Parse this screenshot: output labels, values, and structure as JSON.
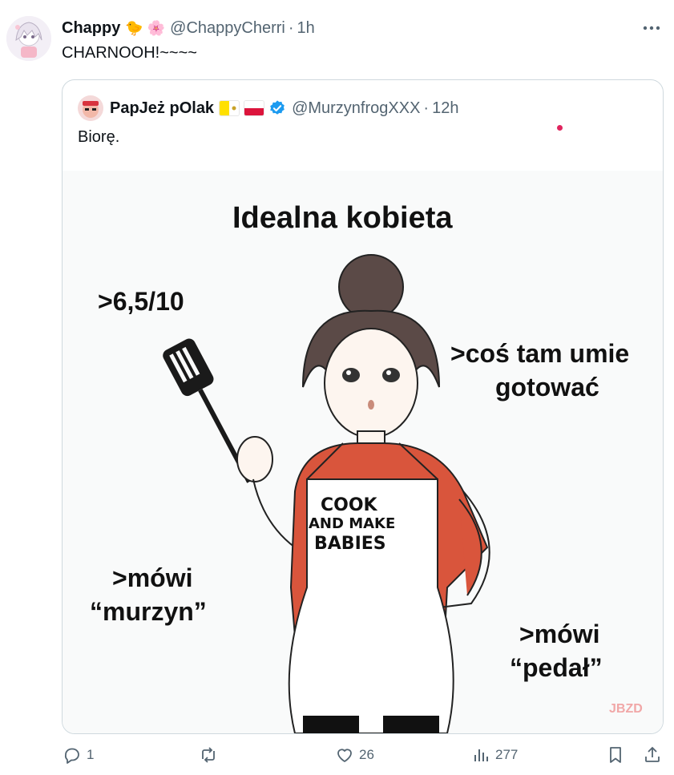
{
  "tweet": {
    "author_name": "Chappy",
    "author_emojis": "🐤 🌸",
    "handle": "@ChappyCherri",
    "separator": "·",
    "time": "1h",
    "text": "CHARNOOH!~~~~"
  },
  "quote": {
    "author_name": "PapJeż pOlak",
    "handle": "@MurzynfrogXXX",
    "separator": "·",
    "time": "12h",
    "text": "Biorę.",
    "image": {
      "title": "Idealna kobieta",
      "top_left": ">6,5/10",
      "top_right_1": ">coś tam umie",
      "top_right_2": "gotować",
      "apron_1": "COOK",
      "apron_2": "AND MAKE",
      "apron_3": "BABIES",
      "bottom_left_1": ">mówi",
      "bottom_left_2": "“murzyn”",
      "bottom_right_1": ">mówi",
      "bottom_right_2": "“pedał”",
      "watermark": "JBZD"
    }
  },
  "actions": {
    "reply_count": "1",
    "retweet_count": "",
    "like_count": "26",
    "views_count": "277"
  },
  "colors": {
    "text_primary": "#0f1419",
    "text_secondary": "#536471",
    "border": "#cfd9de",
    "verified_blue": "#1d9bf0",
    "shirt_red": "#d9553c"
  },
  "icons": [
    "more-icon",
    "verified-icon",
    "reply-icon",
    "retweet-icon",
    "like-icon",
    "views-icon",
    "bookmark-icon",
    "share-icon"
  ]
}
